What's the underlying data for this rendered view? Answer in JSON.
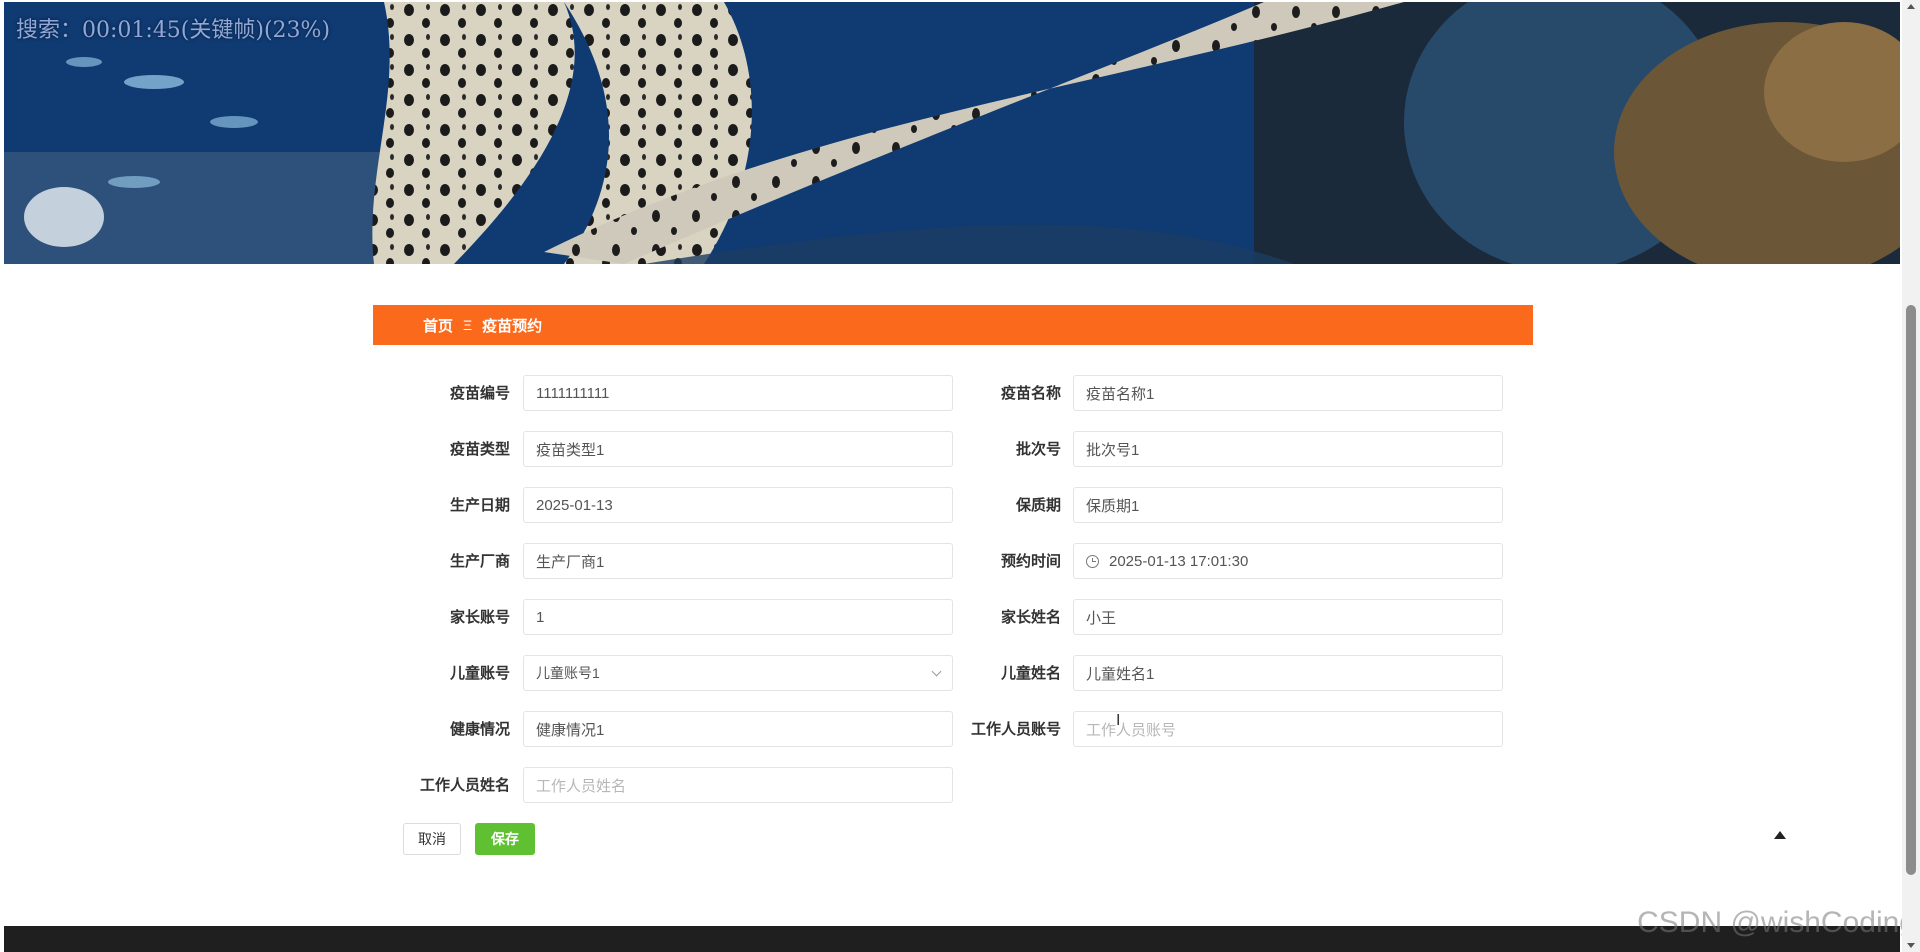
{
  "overlay": {
    "text": "搜索：00:01:45(关键帧)(23%)"
  },
  "watermark": {
    "text": "CSDN @wishCoding"
  },
  "breadcrumb": {
    "home": "首页",
    "separator": "Ξ",
    "current": "疫苗预约"
  },
  "form": {
    "vaccine_code": {
      "label": "疫苗编号",
      "value": "1111111111"
    },
    "vaccine_name": {
      "label": "疫苗名称",
      "value": "疫苗名称1"
    },
    "vaccine_type": {
      "label": "疫苗类型",
      "value": "疫苗类型1"
    },
    "batch_no": {
      "label": "批次号",
      "value": "批次号1"
    },
    "production_date": {
      "label": "生产日期",
      "value": "2025-01-13"
    },
    "shelf_life": {
      "label": "保质期",
      "value": "保质期1"
    },
    "manufacturer": {
      "label": "生产厂商",
      "value": "生产厂商1"
    },
    "appointment_time": {
      "label": "预约时间",
      "value": "2025-01-13 17:01:30"
    },
    "parent_account": {
      "label": "家长账号",
      "value": "1"
    },
    "parent_name": {
      "label": "家长姓名",
      "value": "小王"
    },
    "child_account": {
      "label": "儿童账号",
      "value": "儿童账号1"
    },
    "child_name": {
      "label": "儿童姓名",
      "value": "儿童姓名1"
    },
    "health": {
      "label": "健康情况",
      "value": "健康情况1"
    },
    "staff_account": {
      "label": "工作人员账号",
      "placeholder": "工作人员账号"
    },
    "staff_name": {
      "label": "工作人员姓名",
      "placeholder": "工作人员姓名"
    }
  },
  "actions": {
    "cancel": "取消",
    "save": "保存"
  },
  "colors": {
    "header": "#fb6a1c",
    "save": "#5fc132",
    "footer": "#1f1f1f"
  },
  "icons": {
    "time": "clock-icon",
    "select": "chevron-down-icon",
    "back_to_top": "triangle-up-icon"
  }
}
